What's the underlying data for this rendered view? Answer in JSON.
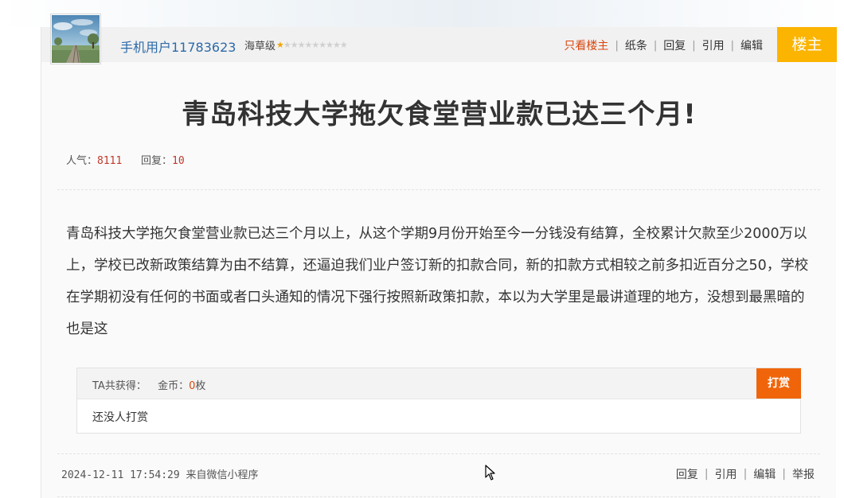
{
  "user": {
    "name": "手机用户11783623",
    "level_label": "海草级",
    "stars_on": 1,
    "stars_total": 10
  },
  "actions": {
    "only_owner": "只看楼主",
    "note": "纸条",
    "reply": "回复",
    "quote": "引用",
    "edit": "编辑",
    "sep": "|"
  },
  "owner_badge": "楼主",
  "post": {
    "title": "青岛科技大学拖欠食堂营业款已达三个月!",
    "popularity_label": "人气：",
    "popularity": "8111",
    "replies_label": "回复：",
    "replies": "10",
    "content": "青岛科技大学拖欠食堂营业款已达三个月以上，从这个学期9月份开始至今一分钱没有结算，全校累计欠款至少2000万以上，学校已改新政策结算为由不结算，还逼迫我们业户签订新的扣款合同，新的扣款方式相较之前多扣近百分之50，学校在学期初没有任何的书面或者口头通知的情况下强行按照新政策扣款，本以为大学里是最讲道理的地方，没想到最黑暗的也是这"
  },
  "reward": {
    "received_label": "TA共获得：",
    "coin_label": "金币：",
    "coins": "0",
    "unit": "枚",
    "button": "打赏",
    "empty": "还没人打赏"
  },
  "footer": {
    "timestamp": "2024-12-11 17:54:29",
    "source": "来自微信小程序",
    "reply": "回复",
    "quote": "引用",
    "edit": "编辑",
    "report": "举报",
    "sep": "|"
  },
  "colors": {
    "owner_badge": "#fbb400",
    "reward_button": "#f0650a",
    "username": "#2c6aa8",
    "highlight": "#d9480f"
  },
  "icons": [
    "star-icon",
    "cursor-icon",
    "avatar"
  ]
}
